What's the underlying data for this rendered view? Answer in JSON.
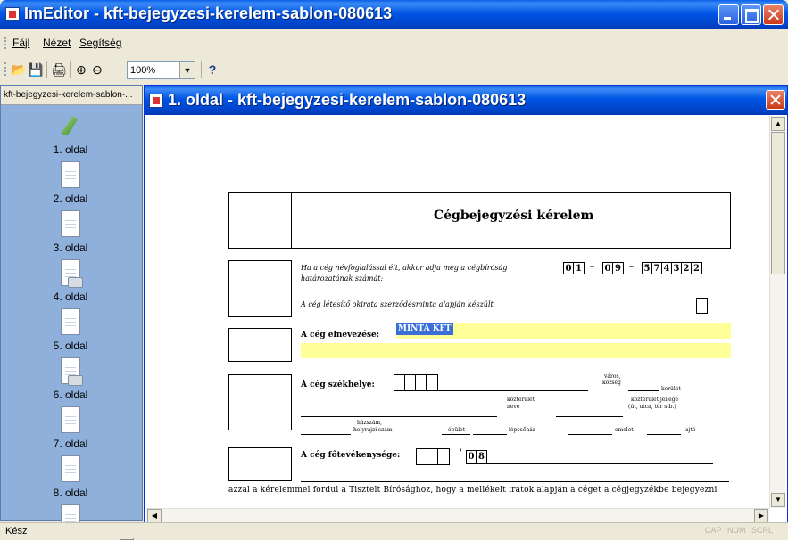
{
  "app": {
    "title": "ImEditor - kft-bejegyzesi-kerelem-sablon-080613"
  },
  "menu": [
    "Fájl",
    "Nézet",
    "Segítség"
  ],
  "toolbar": {
    "zoom": "100%",
    "icons": [
      "open-icon",
      "save-icon",
      "print-icon",
      "zoom-in-icon",
      "zoom-out-icon",
      "help-icon"
    ]
  },
  "sidebar": {
    "header": "kft-bejegyzesi-kerelem-sablon-...",
    "pages": [
      "1. oldal",
      "2. oldal",
      "3. oldal",
      "4. oldal",
      "5. oldal",
      "6. oldal",
      "7. oldal",
      "8. oldal"
    ]
  },
  "document": {
    "title": "1. oldal - kft-bejegyzesi-kerelem-sablon-080613"
  },
  "form": {
    "heading": "Cégbejegyzési kérelem",
    "registry_question_1": "Ha a cég névfoglalással élt, akkor adja meg a cégbíróság",
    "registry_question_2": "határozatának számát:",
    "registry_digits_a": [
      "0",
      "1"
    ],
    "registry_digits_b": [
      "0",
      "9"
    ],
    "registry_digits_c": [
      "5",
      "7",
      "4",
      "3",
      "2",
      "2"
    ],
    "dash": "–",
    "template_question": "A cég létesítő okirata szerződésminta alapján készült",
    "name_label": "A cég elnevezése:",
    "name_value": "MINTA KFT",
    "seat_label": "A cég székhelye:",
    "city_1": "város,",
    "city_2": "község",
    "district": "kerület",
    "street_name_1": "közterület",
    "street_name_2": "neve",
    "street_type_1": "közterület jellege",
    "street_type_2": "(út, utca, tér stb.)",
    "house_1": "házszám,",
    "house_2": "helyrajzi szám",
    "building": "épület",
    "staircase": "lépcsőház",
    "floor": "emelet",
    "door": "ajtó",
    "activity_label": "A cég főtevékenysége:",
    "activity_digits": [
      "0",
      "8"
    ],
    "activity_comma": "'",
    "closing_text": "azzal a kérelemmel fordul a Tisztelt Bírósághoz, hogy a mellékelt iratok alapján a céget a cégjegyzékbe bejegyezni"
  },
  "status": {
    "text": "Kész",
    "caps": "CAP",
    "num": "NUM",
    "scrl": "SCRL"
  }
}
